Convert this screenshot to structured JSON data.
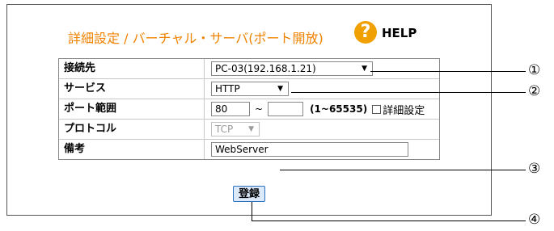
{
  "header": {
    "title": "詳細設定 / バーチャル・サーバ(ポート開放)",
    "help_symbol": "?",
    "help_label": "HELP"
  },
  "form": {
    "destination": {
      "label": "接続先",
      "value": "PC-03(192.168.1.21)"
    },
    "service": {
      "label": "サービス",
      "value": "HTTP"
    },
    "port_range": {
      "label": "ポート範囲",
      "from_value": "80",
      "separator": "~",
      "to_value": "",
      "range_note": "(1~65535)",
      "detail_label": "詳細設定",
      "detail_checked": false
    },
    "protocol": {
      "label": "プロトコル",
      "value": "TCP"
    },
    "note": {
      "label": "備考",
      "value": "WebServer"
    }
  },
  "register_button": {
    "label": "登録"
  },
  "callouts": [
    "①",
    "②",
    "③",
    "④"
  ],
  "icons": {
    "dropdown_arrow": "▼"
  }
}
